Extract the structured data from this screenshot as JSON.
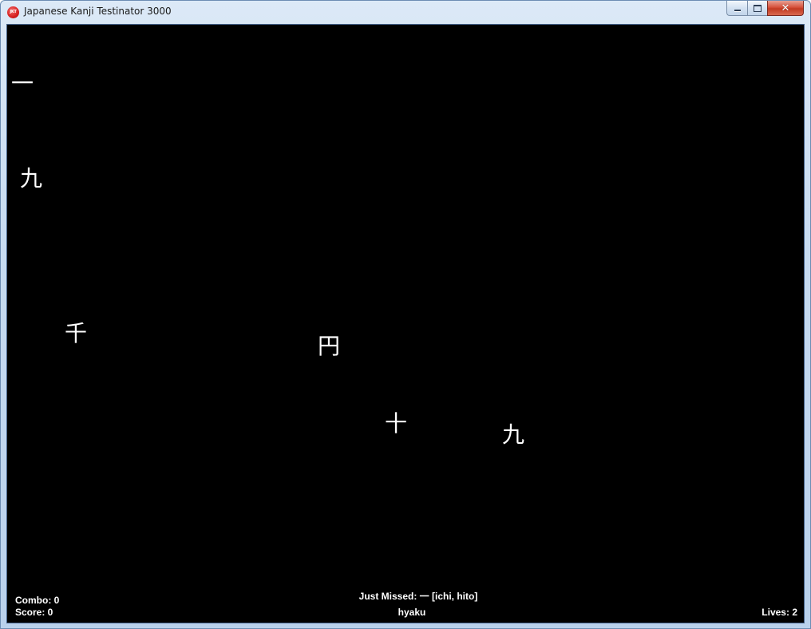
{
  "window": {
    "title": "Japanese Kanji Testinator 3000",
    "icon_label": "JKT",
    "minimize_icon": "minimize-icon",
    "maximize_icon": "maximize-icon",
    "close_icon": "close-icon",
    "close_glyph": "✕"
  },
  "game": {
    "kanji": [
      "一",
      "九",
      "千",
      "円",
      "十",
      "九"
    ],
    "combo": "Combo: 0",
    "score": "Score: 0",
    "just_missed": "Just Missed: 一  [ichi, hito]",
    "current_input": "hyaku",
    "lives": "Lives: 2"
  },
  "colors": {
    "background": "#000000",
    "text": "#ffffff",
    "icon_red": "#d61f1f",
    "close_red": "#c13a22"
  }
}
